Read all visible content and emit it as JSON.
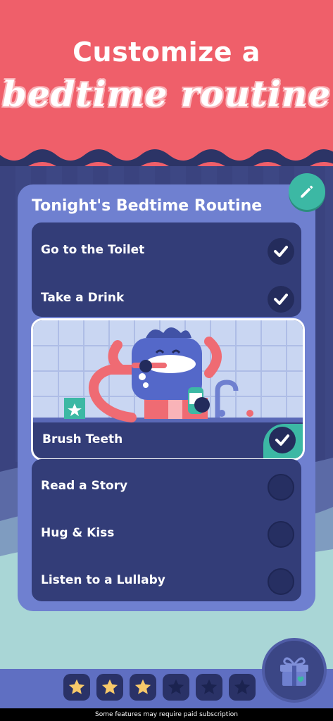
{
  "hero": {
    "line1": "Customize a",
    "line2": "bedtime routine"
  },
  "card": {
    "title": "Tonight's Bedtime Routine"
  },
  "routine": [
    {
      "label": "Go to the Toilet",
      "checked": true
    },
    {
      "label": "Take a Drink",
      "checked": true
    },
    {
      "label": "Brush Teeth",
      "checked": true
    },
    {
      "label": "Read a Story",
      "checked": false
    },
    {
      "label": "Hug & Kiss",
      "checked": false
    },
    {
      "label": "Listen to a Lullaby",
      "checked": false
    }
  ],
  "stars": {
    "earned": 3,
    "total": 6
  },
  "icons": {
    "edit": "pencil-icon",
    "check": "check-icon",
    "star": "star-icon",
    "gift": "gift-icon"
  },
  "colors": {
    "hero": "#ef5f6a",
    "background": "#3a437f",
    "card": "#6f80d0",
    "accent": "#3cb8a4",
    "star_earned": "#f7c96a"
  },
  "footer": {
    "text": "Some features may require paid subscription"
  }
}
